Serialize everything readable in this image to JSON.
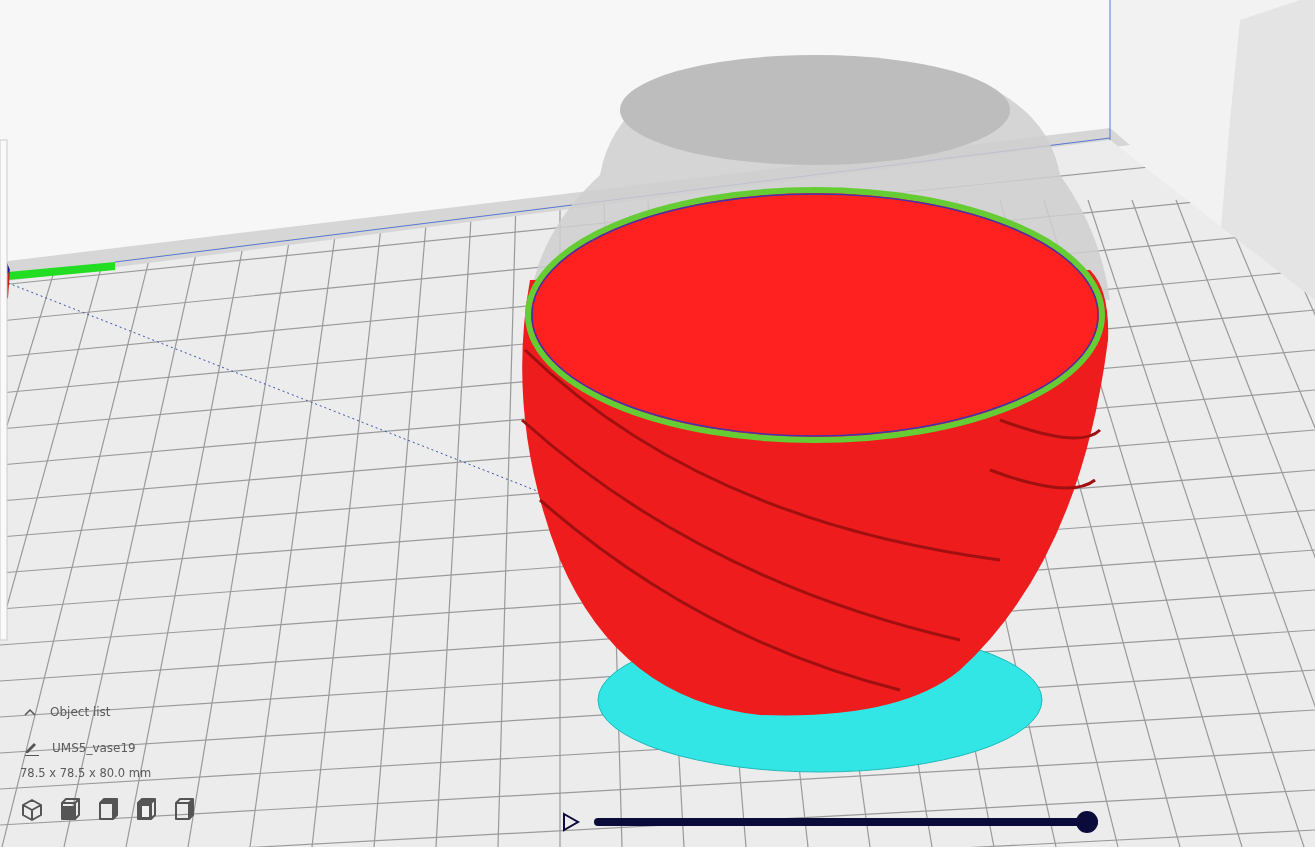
{
  "object_list": {
    "title": "Object list",
    "expanded": true,
    "object_name": "UMS5_vase19",
    "dimensions": "78.5 x 78.5 x 80.0 mm"
  },
  "layer_slider": {
    "level": 1
  }
}
